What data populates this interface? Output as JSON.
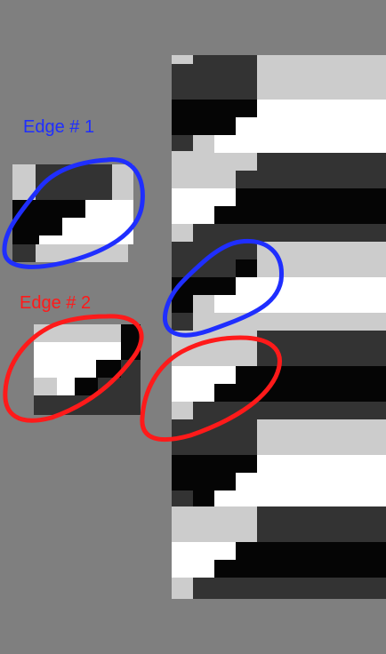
{
  "annotations": {
    "edge1": {
      "text": "Edge # 1",
      "color": "#1f2eff"
    },
    "edge2": {
      "text": "Edge # 2",
      "color": "#ff1a1a"
    }
  },
  "palette": {
    "background": "#7f7f7f",
    "black": "#050505",
    "dark_gray": "#333333",
    "light_gray": "#cccccc",
    "white": "#ffffff"
  }
}
